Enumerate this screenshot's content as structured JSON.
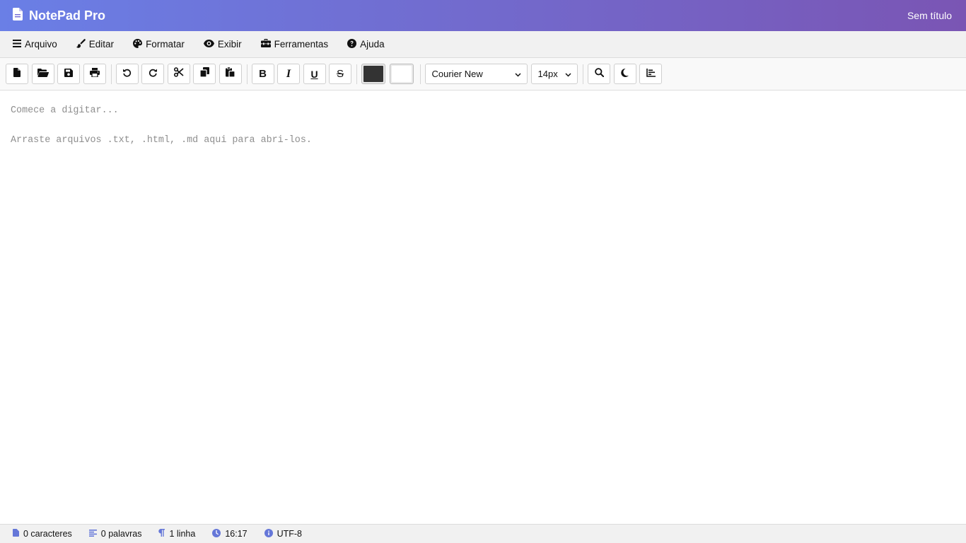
{
  "app": {
    "name": "NotePad Pro",
    "document_title": "Sem título"
  },
  "menu": [
    {
      "label": "Arquivo",
      "icon": "bars-icon"
    },
    {
      "label": "Editar",
      "icon": "brush-icon"
    },
    {
      "label": "Formatar",
      "icon": "palette-icon"
    },
    {
      "label": "Exibir",
      "icon": "eye-icon"
    },
    {
      "label": "Ferramentas",
      "icon": "toolbox-icon"
    },
    {
      "label": "Ajuda",
      "icon": "question-circle-icon"
    }
  ],
  "toolbar": {
    "format_labels": {
      "bold": "B",
      "italic": "I",
      "underline": "U",
      "strikethrough": "S"
    },
    "text_color": "#333333",
    "background_color": "#ffffff",
    "font_family": "Courier New",
    "font_size": "14px"
  },
  "editor": {
    "placeholder": "Comece a digitar...\n\nArraste arquivos .txt, .html, .md aqui para abri-los."
  },
  "status": {
    "characters": "0 caracteres",
    "words": "0 palavras",
    "lines": "1 linha",
    "time": "16:17",
    "encoding": "UTF-8"
  },
  "colors": {
    "accent": "#6577d8",
    "gradient_start": "#6a7fe6",
    "gradient_end": "#7a55b4"
  }
}
